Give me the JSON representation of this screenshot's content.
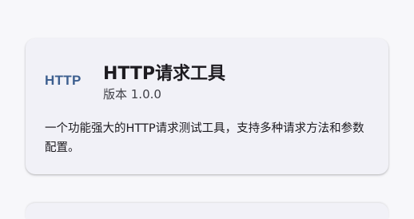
{
  "app_card": {
    "logo_text": "HTTP",
    "title": "HTTP请求工具",
    "version": "版本 1.0.0",
    "description": "一个功能强大的HTTP请求测试工具，支持多种请求方法和参数配置。"
  },
  "colors": {
    "page_background": "#f7f7fa",
    "card_background": "#f1f1f7",
    "logo": "#3d5f8f",
    "title_text": "#1d1b20"
  }
}
